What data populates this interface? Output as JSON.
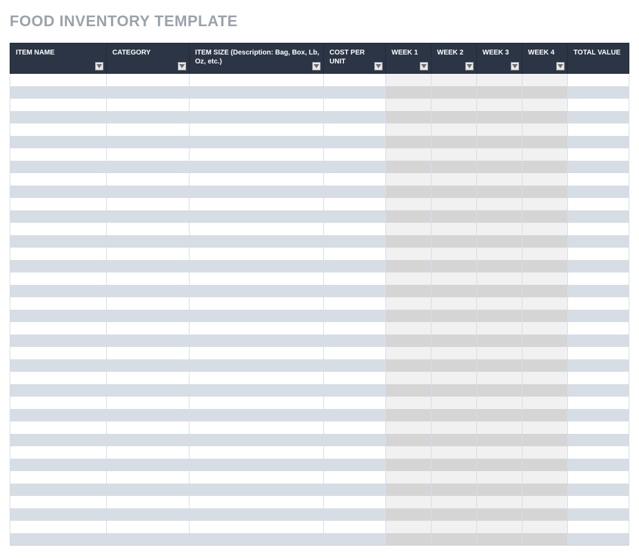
{
  "title": "FOOD INVENTORY  TEMPLATE",
  "columns": [
    {
      "key": "item_name",
      "label": "ITEM NAME",
      "filter": true
    },
    {
      "key": "category",
      "label": "CATEGORY",
      "filter": true
    },
    {
      "key": "item_size",
      "label": "ITEM SIZE (Description: Bag, Box, Lb, Oz, etc.)",
      "filter": true
    },
    {
      "key": "cost",
      "label": "COST PER UNIT",
      "filter": true
    },
    {
      "key": "week1",
      "label": "WEEK 1",
      "filter": true,
      "week": true
    },
    {
      "key": "week2",
      "label": "WEEK 2",
      "filter": true,
      "week": true
    },
    {
      "key": "week3",
      "label": "WEEK 3",
      "filter": true,
      "week": true
    },
    {
      "key": "week4",
      "label": "WEEK 4",
      "filter": true,
      "week": true
    },
    {
      "key": "total",
      "label": "TOTAL VALUE",
      "filter": false
    }
  ],
  "row_count": 38
}
